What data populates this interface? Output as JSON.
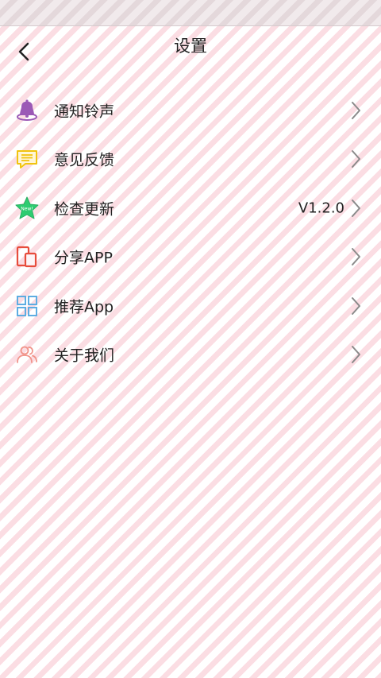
{
  "header": {
    "title": "设置",
    "back_icon": "chevron-left-icon"
  },
  "menu": {
    "items": [
      {
        "id": "notification-sound",
        "label": "通知铃声",
        "icon": "bell-icon",
        "color": "#9b59b6"
      },
      {
        "id": "feedback",
        "label": "意见反馈",
        "icon": "message-icon",
        "color": "#f1c40f"
      },
      {
        "id": "check-update",
        "label": "检查更新",
        "icon": "star-new-icon",
        "color": "#2ecc71",
        "badge_text": "New!",
        "value": "V1.2.0"
      },
      {
        "id": "share-app",
        "label": "分享APP",
        "icon": "share-devices-icon",
        "color": "#e74c3c"
      },
      {
        "id": "recommend-app",
        "label": "推荐App",
        "icon": "grid-icon",
        "color": "#5dade2"
      },
      {
        "id": "about-us",
        "label": "关于我们",
        "icon": "people-icon",
        "color": "#f1948a"
      }
    ]
  },
  "colors": {
    "stripe_pink": "#fbdde3",
    "text": "#222222",
    "chevron": "#8a8a8a"
  }
}
